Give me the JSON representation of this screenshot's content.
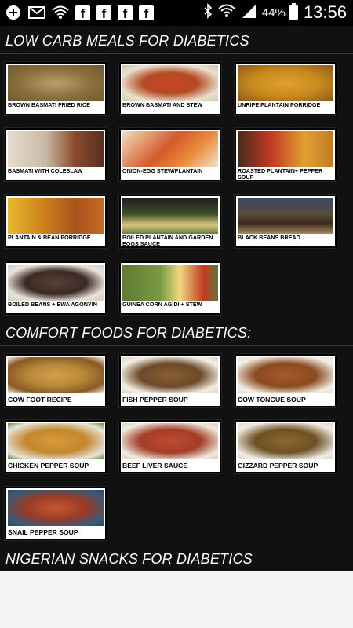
{
  "status_bar": {
    "battery": "44%",
    "time": "13:56",
    "icons": [
      "plus-icon",
      "mail-icon",
      "wifi-icon",
      "facebook-icon",
      "facebook-icon",
      "facebook-icon",
      "facebook-icon",
      "bluetooth-icon",
      "signal-icon",
      "battery-icon"
    ]
  },
  "sections": [
    {
      "title": "LOW CARB MEALS FOR DIABETICS",
      "items": [
        {
          "label": "BROWN BASMATI FRIED RICE",
          "color": "#8a6f3c"
        },
        {
          "label": "BROWN BASMATI AND STEW",
          "color": "#b54a22"
        },
        {
          "label": "UNRIPE PLANTAIN PORRIDGE",
          "color": "#c98a1e"
        },
        {
          "label": "BASMATI WITH COLESLAW",
          "color": "#a48a6e"
        },
        {
          "label": "ONION-EGG STEW/PLANTAIN",
          "color": "#d45a2c"
        },
        {
          "label": "ROASTED PLANTAIN+ PEPPER SOUP",
          "color": "#c27a24"
        },
        {
          "label": "PLANTAIN & BEAN PORRIDGE",
          "color": "#cc7e1c"
        },
        {
          "label": "BOILED PLANTAIN and GARDEN EGGS SAUCE",
          "color": "#3f4f28"
        },
        {
          "label": "BLACK BEANS BREAD",
          "color": "#5a4a3a"
        },
        {
          "label": "BOILED BEANS + EWA AGONYIN",
          "color": "#5a4038"
        },
        {
          "label": "GUINEA CORN AGIDI + STEW",
          "color": "#5e7a34"
        }
      ]
    },
    {
      "title": "COMFORT FOODS FOR DIABETICS:",
      "items": [
        {
          "label": "COW FOOT RECIPE",
          "color": "#b98a3c"
        },
        {
          "label": "FISH PEPPER SOUP",
          "color": "#6b4a2a"
        },
        {
          "label": "COW TONGUE SOUP",
          "color": "#8a4a20"
        },
        {
          "label": "CHICKEN PEPPER SOUP",
          "color": "#c4872e"
        },
        {
          "label": "BEEF LIVER SAUCE",
          "color": "#a23e28"
        },
        {
          "label": "GIZZARD PEPPER SOUP",
          "color": "#6e5024"
        },
        {
          "label": "SNAIL PEPPER SOUP",
          "color": "#9a3a26"
        }
      ]
    },
    {
      "title": "NIGERIAN SNACKS FOR DIABETICS",
      "items": []
    }
  ]
}
